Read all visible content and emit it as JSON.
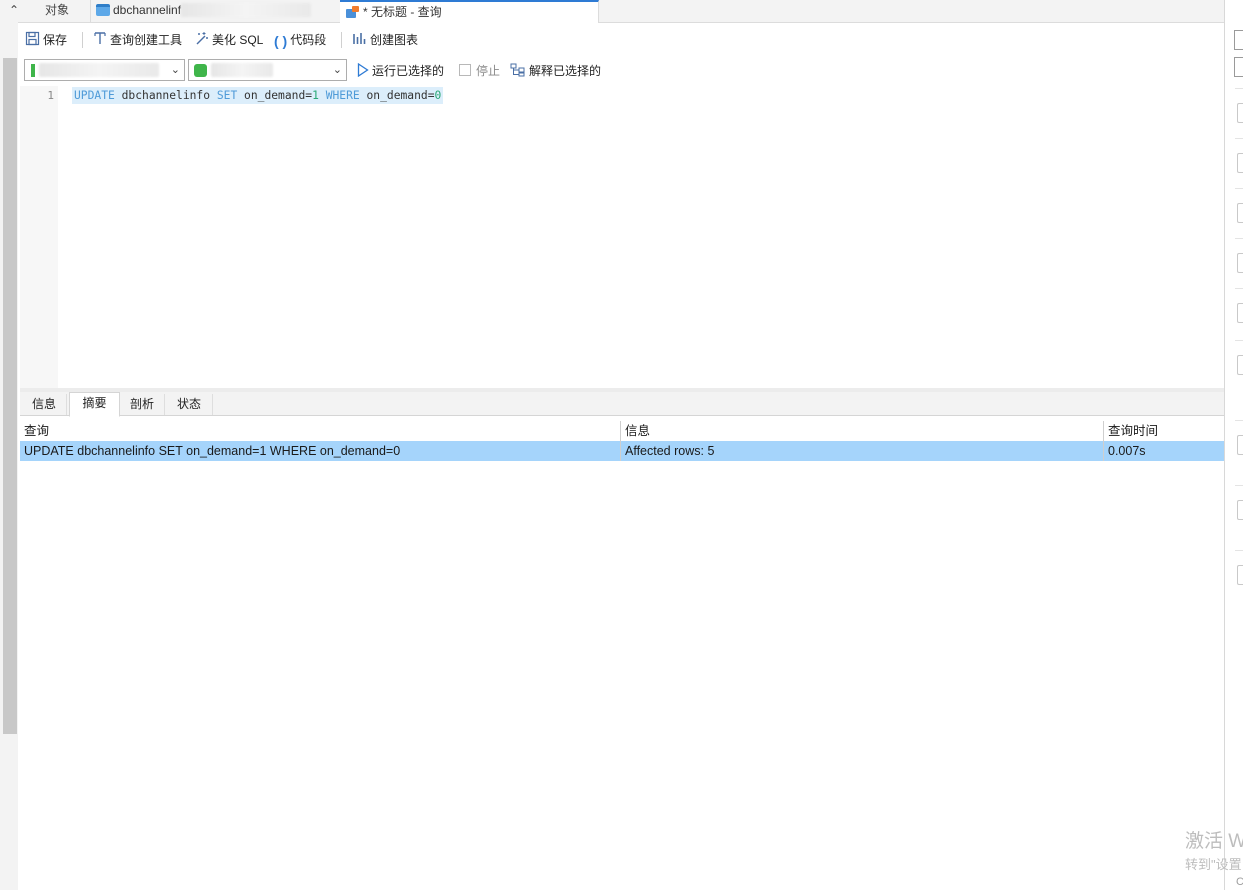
{
  "tabs": {
    "objects": "对象",
    "table_name": "dbchannelinf",
    "query_title": "* 无标题 - 查询"
  },
  "toolbar": {
    "save": "保存",
    "query_builder": "查询创建工具",
    "beautify_sql": "美化 SQL",
    "code_snippet": "代码段",
    "create_chart": "创建图表"
  },
  "selectors": {
    "run_selected": "运行已选择的",
    "stop": "停止",
    "explain_selected": "解释已选择的"
  },
  "editor": {
    "line_number": "1",
    "kw_update": "UPDATE",
    "table": " dbchannelinfo ",
    "kw_set": "SET",
    "assign": " on_demand=",
    "val1": "1",
    "kw_where": " WHERE",
    "cond": " on_demand=",
    "val0": "0"
  },
  "result_tabs": [
    "信息",
    "摘要",
    "剖析",
    "状态"
  ],
  "result_grid": {
    "headers": [
      "查询",
      "信息",
      "查询时间"
    ],
    "rows": [
      [
        "UPDATE dbchannelinfo SET on_demand=1 WHERE on_demand=0",
        "Affected rows: 5",
        "0.007s"
      ]
    ]
  },
  "watermark": {
    "line1": "激活 W",
    "line2": "转到\"设置",
    "line3": "C"
  },
  "colors": {
    "selection": "#a5d4fb",
    "keyword": "#4f9bd8",
    "number": "#2aa876",
    "accent": "#2e7bd4"
  }
}
